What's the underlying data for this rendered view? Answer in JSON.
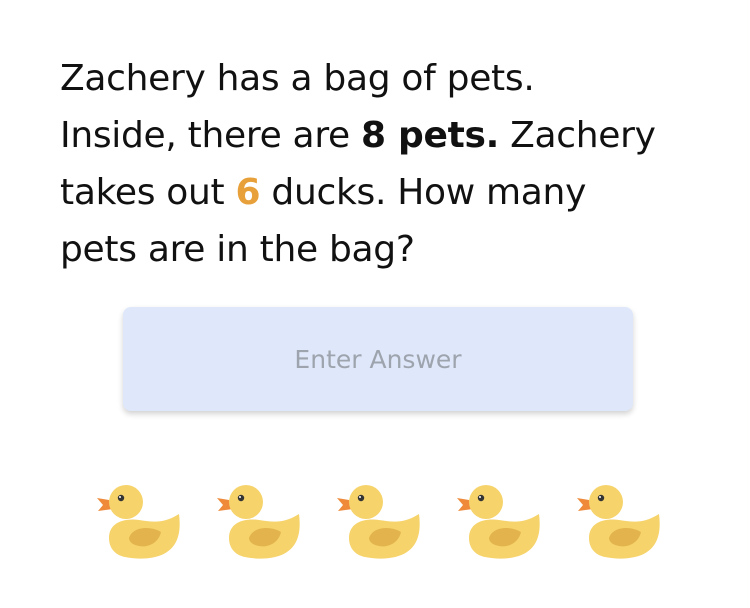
{
  "question": {
    "line1": "Zachery has a bag of pets.",
    "line2_prefix": "Inside, there are ",
    "line2_bold": "8 pets.",
    "line2_suffix": " Zachery",
    "line3_prefix": "takes out ",
    "line3_number": "6",
    "line3_suffix": " ducks. How many",
    "line4": "pets are in the bag?"
  },
  "answer": {
    "value": "",
    "placeholder": "Enter Answer"
  },
  "ducks": {
    "icon": "duck-icon",
    "count": 5
  },
  "colors": {
    "highlight": "#e8a13a",
    "answer_bg": "#dfe8fa",
    "placeholder": "#9ea4ad",
    "duck_body": "#f6d36b",
    "duck_wing": "#e3b44e",
    "duck_beak": "#ee8a3a"
  }
}
